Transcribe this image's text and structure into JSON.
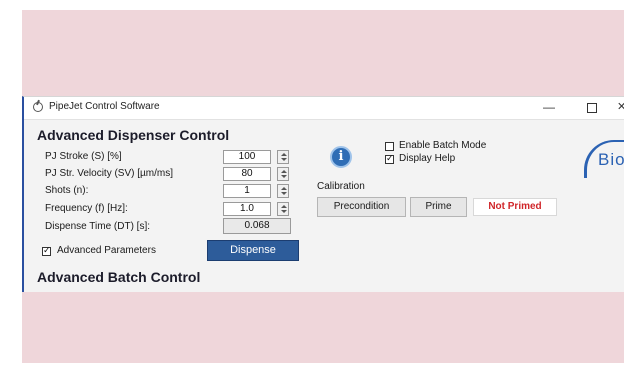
{
  "window": {
    "title": "PipeJet Control Software",
    "controls": {
      "minimize": "—",
      "close": "✕"
    }
  },
  "dispenser": {
    "title": "Advanced Dispenser Control",
    "params": [
      {
        "label": "PJ Stroke (S) [%]",
        "value": "100"
      },
      {
        "label": "PJ Str. Velocity (SV) [µm/ms]",
        "value": "80"
      },
      {
        "label": "Shots (n):",
        "value": "1"
      },
      {
        "label": "Frequency (f) [Hz]:",
        "value": "1.0"
      }
    ],
    "dispense_time": {
      "label": "Dispense Time (DT) [s]:",
      "value": "0.068"
    },
    "advanced_parameters": {
      "label": "Advanced Parameters",
      "checked": true
    },
    "dispense_button": "Dispense"
  },
  "options": {
    "info_icon": "i",
    "enable_batch_mode": {
      "label": "Enable Batch Mode",
      "checked": false
    },
    "display_help": {
      "label": "Display Help",
      "checked": true
    }
  },
  "calibration": {
    "label": "Calibration",
    "precondition_button": "Precondition",
    "prime_button": "Prime",
    "status": "Not Primed"
  },
  "logo": {
    "text": "Bio"
  },
  "batch": {
    "title": "Advanced Batch Control"
  },
  "colors": {
    "background": "#efd6da",
    "accent": "#2d5c9a",
    "status_alert": "#d0262a"
  }
}
